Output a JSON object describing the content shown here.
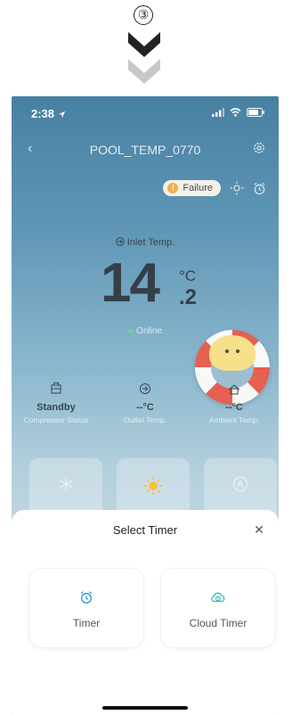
{
  "step": {
    "number": "③"
  },
  "status_bar": {
    "time": "2:38"
  },
  "device": {
    "name": "POOL_TEMP_0770"
  },
  "fault": {
    "label": "Failure"
  },
  "inlet": {
    "label": "Inlet Temp.",
    "value_int": "14",
    "value_dec": ".2",
    "unit": "°C"
  },
  "connection": {
    "status": "Online"
  },
  "stats": [
    {
      "value": "Standby",
      "label": "Compressor Status",
      "icon": "compressor-icon"
    },
    {
      "value": "--°C",
      "label": "Outlet Temp.",
      "icon": "outlet-icon"
    },
    {
      "value": "--°C",
      "label": "Ambient Temp.",
      "icon": "ambient-icon"
    }
  ],
  "modes": [
    {
      "icon": "snowflake-icon"
    },
    {
      "icon": "sun-icon"
    },
    {
      "icon": "auto-icon"
    }
  ],
  "sheet": {
    "title": "Select Timer",
    "options": [
      {
        "label": "Timer",
        "icon": "alarm-clock-icon"
      },
      {
        "label": "Cloud Timer",
        "icon": "cloud-timer-icon"
      }
    ]
  },
  "colors": {
    "accent": "#2f8fd8",
    "failure": "#f2a33a"
  }
}
